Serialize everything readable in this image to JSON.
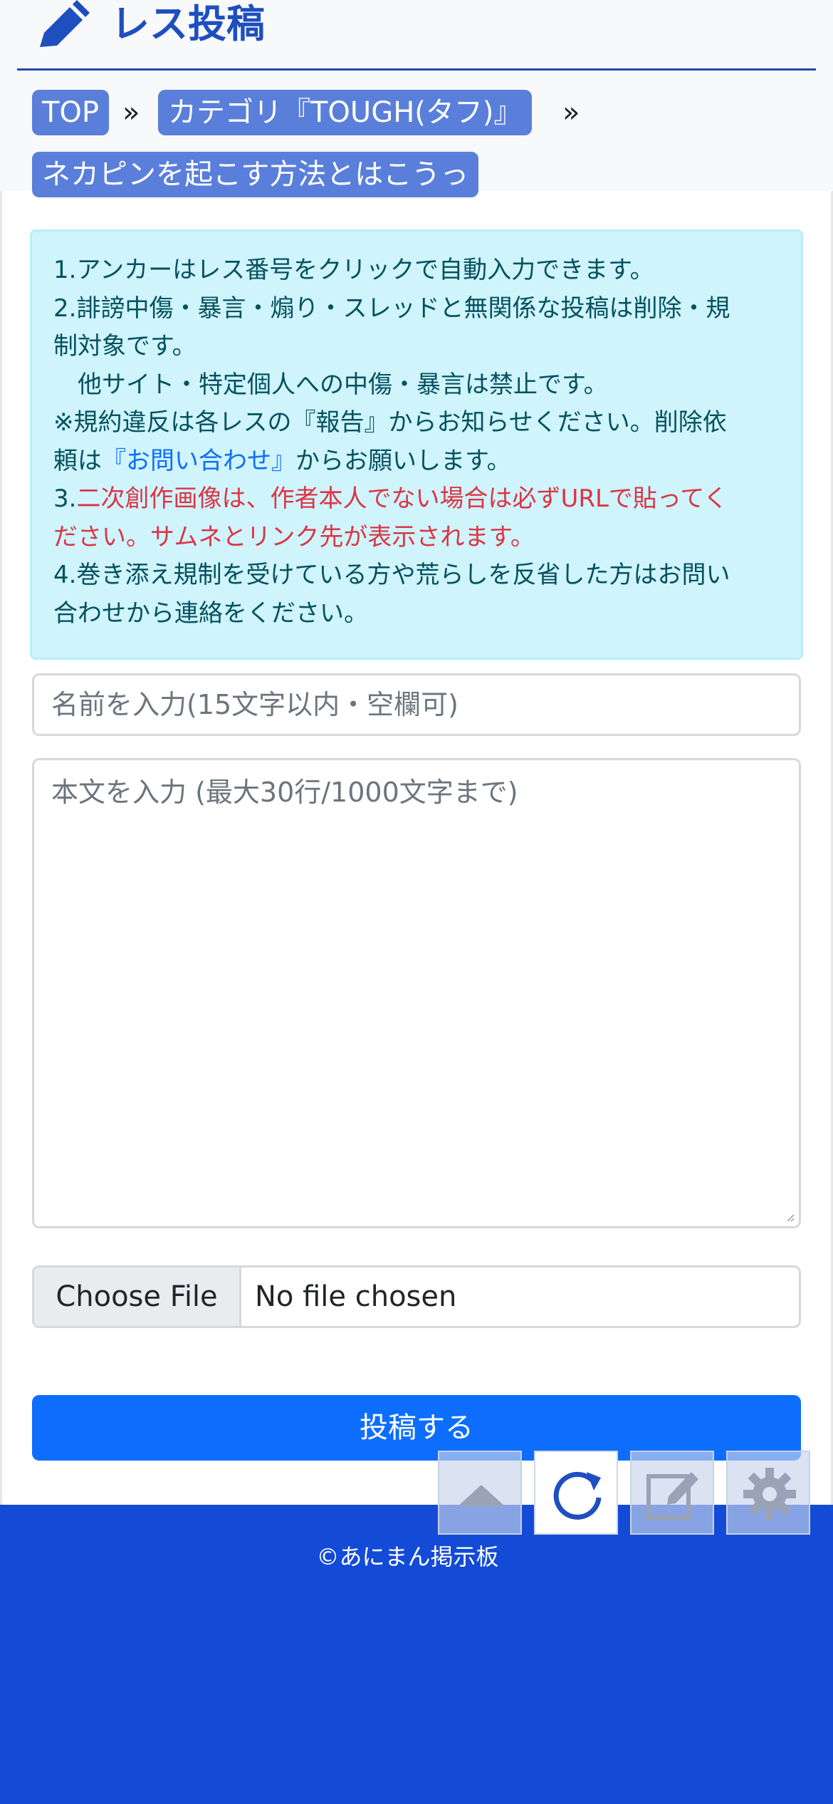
{
  "header": {
    "title": "レス投稿",
    "icon": "pencil-icon"
  },
  "breadcrumb": {
    "items": [
      {
        "label": "TOP"
      },
      {
        "label": "カテゴリ『TOUGH(タフ)』"
      },
      {
        "label": "ネカピンを起こす方法とはこうっ"
      }
    ],
    "separator": "»"
  },
  "notice": {
    "line1": "1.アンカーはレス番号をクリックで自動入力できます。",
    "line2": "2.誹謗中傷・暴言・煽り・スレッドと無関係な投稿は削除・規",
    "line3": "制対象です。",
    "line4": "　他サイト・特定個人への中傷・暴言は禁止です。",
    "line5": "※規約違反は各レスの『報告』からお知らせください。削除依",
    "line6_pre": "頼は",
    "line6_link": "『お問い合わせ』",
    "line6_post": "からお願いします。",
    "line7_num": "3.",
    "line7": "二次創作画像は、作者本人でない場合は必ずURLで貼ってく",
    "line8": "ださい。サムネとリンク先が表示されます。",
    "line9": "4.巻き添え規制を受けている方や荒らしを反省した方はお問い",
    "line10": "合わせから連絡をください。"
  },
  "form": {
    "name_placeholder": "名前を入力(15文字以内・空欄可)",
    "name_value": "",
    "body_placeholder": "本文を入力 (最大30行/1000文字まで)",
    "body_value": "",
    "file_button": "Choose File",
    "file_status": "No file chosen",
    "submit_label": "投稿する"
  },
  "footer": {
    "copyright": "©あにまん掲示板"
  },
  "floating_buttons": [
    {
      "icon": "scroll-up-icon"
    },
    {
      "icon": "refresh-icon"
    },
    {
      "icon": "edit-icon"
    },
    {
      "icon": "gear-icon"
    }
  ],
  "colors": {
    "accent": "#1d4fbf",
    "breadcrumb_bg": "#5a7fdb",
    "notice_bg": "#cff4fc",
    "notice_text": "#055160",
    "warning_text": "#dc3545",
    "link": "#0d6efd",
    "submit_bg": "#0d6efd",
    "footer_bg": "#134bd6"
  }
}
